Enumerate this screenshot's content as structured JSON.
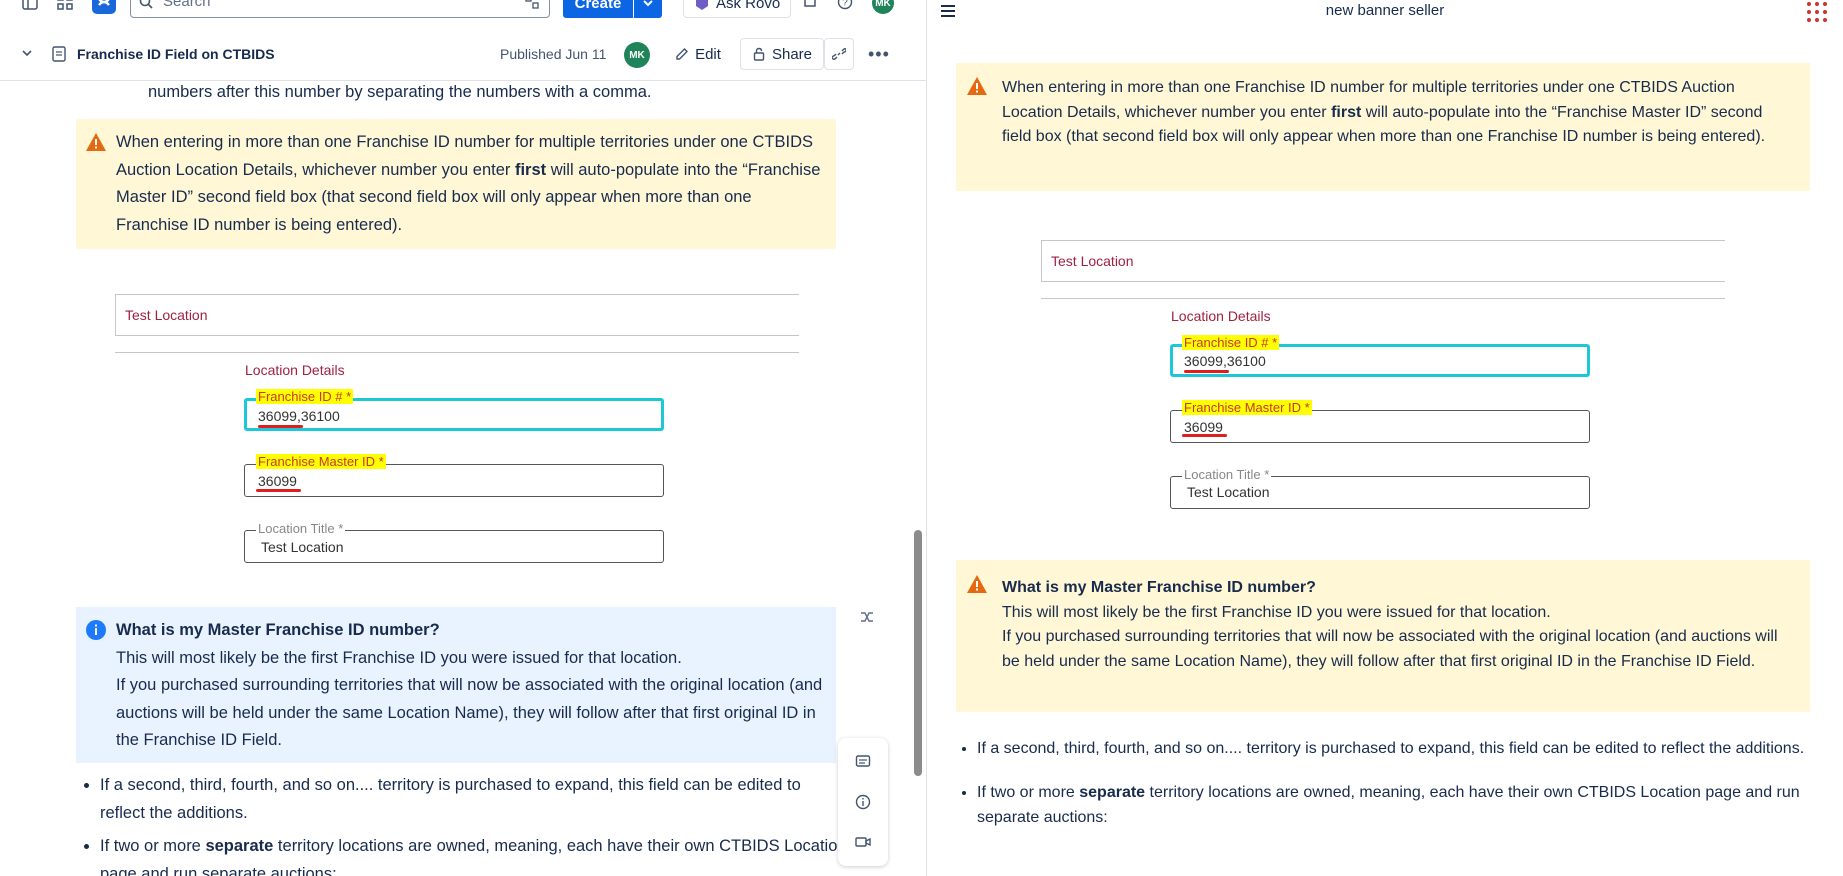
{
  "left": {
    "search": {
      "placeholder": "Search"
    },
    "create_label": "Create",
    "ask_rovo_label": "Ask Rovo",
    "avatar_initials": "MK",
    "page_title": "Franchise ID Field on CTBIDS",
    "published": "Published Jun 11",
    "edit_label": "Edit",
    "share_label": "Share",
    "intro_tail": "numbers after this number by separating the numbers with a comma.",
    "warn_panel": {
      "before": "When entering in more than one Franchise ID number for multiple territories under one CTBIDS Auction Location Details, whichever number you enter ",
      "bold": "first",
      "after": " will auto-populate into the “Franchise Master ID” second field box (that second field box will only appear when more than one Franchise ID number is being entered)."
    },
    "form": {
      "test_location": "Test Location",
      "location_details": "Location Details",
      "franchise_id_label": "Franchise ID # *",
      "franchise_id_value_a": "36099",
      "franchise_id_value_b": ",36100",
      "master_id_label": "Franchise Master ID *",
      "master_id_value": "36099",
      "location_title_label": "Location Title *",
      "location_title_value": "Test Location"
    },
    "info_panel": {
      "heading": "What is my Master Franchise ID number?",
      "line1": "This will most likely be the first Franchise ID you were issued for that location.",
      "line2": "If you purchased surrounding territories that will now be associated with the original location (and auctions will be held under the same Location Name), they will follow after that first original ID in the Franchise ID Field."
    },
    "bullets": {
      "b1": "If a second, third, fourth, and so on.... territory is purchased to expand, this field can be edited to reflect the additions.",
      "b2_before": "If two or more ",
      "b2_bold": "separate",
      "b2_after": " territory locations are owned, meaning, each have their own CTBIDS Location page and run separate auctions:"
    }
  },
  "right": {
    "title": "new banner seller",
    "warn_panel": {
      "before": "When entering in more than one Franchise ID number for multiple territories under one CTBIDS Auction Location Details, whichever number you enter ",
      "bold": "first",
      "after": " will auto-populate into the “Franchise Master ID” second field box (that second field box will only appear when more than one Franchise ID number is being entered)."
    },
    "form": {
      "test_location": "Test Location",
      "location_details": "Location Details",
      "franchise_id_label": "Franchise ID # *",
      "franchise_id_value_a": "36099",
      "franchise_id_value_b": ",36100",
      "master_id_label": "Franchise Master ID *",
      "master_id_value": "36099",
      "location_title_label": "Location Title *",
      "location_title_value": "Test Location"
    },
    "note_panel": {
      "heading": "What is my Master Franchise ID number?",
      "line1": "This will most likely be the first Franchise ID you were issued for that location.",
      "line2": "If you purchased surrounding territories that will now be associated with the original location (and auctions will be held under the same Location Name), they will follow after that first original ID in the Franchise ID Field."
    },
    "bullets": {
      "b1": "If a second, third, fourth, and so on.... territory is purchased to expand, this field can be edited to reflect the additions.",
      "b2_before": "If two or more ",
      "b2_bold": "separate",
      "b2_after": " territory locations are owned, meaning, each have their own CTBIDS Location page and run separate auctions:"
    }
  },
  "colors": {
    "warn_bg": "#fff7d6",
    "info_bg": "#e9f2ff",
    "primary": "#0c66e4",
    "highlight": "#ffff00",
    "field_focus": "#1cc8d8",
    "crimson": "#a02243"
  }
}
